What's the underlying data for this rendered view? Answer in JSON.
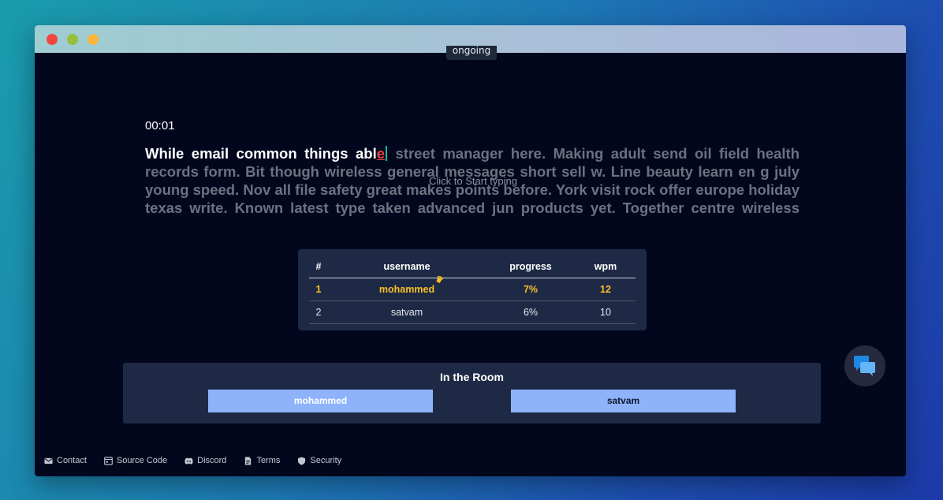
{
  "race": {
    "status": "ongoing",
    "timer": "00:01"
  },
  "passage": {
    "typed": "While email common things abl",
    "current_error": "e",
    "remaining": " street manager here. Making adult send oil field health records form. Bit though wireless general messages short sell w. Line beauty learn en g july young speed. Nov all file safety great makes points before. York visit rock offer europe holiday texas write. Known latest type taken advanced jun products yet. Together centre wireless learn wireless single in",
    "hint": "Click to Start typing"
  },
  "leaderboard": {
    "headers": {
      "rank": "#",
      "username": "username",
      "progress": "progress",
      "wpm": "wpm"
    },
    "rows": [
      {
        "rank": "1",
        "username": "mohammed",
        "progress": "7%",
        "wpm": "12",
        "crown_icon": "crown-icon"
      },
      {
        "rank": "2",
        "username": "satvam",
        "progress": "6%",
        "wpm": "10"
      }
    ]
  },
  "room": {
    "title": "In the Room",
    "players": [
      "mohammed",
      "satvam"
    ]
  },
  "footer": {
    "links": [
      {
        "label": "Contact",
        "icon": "mail-icon"
      },
      {
        "label": "Source Code",
        "icon": "code-window-icon"
      },
      {
        "label": "Discord",
        "icon": "discord-icon"
      },
      {
        "label": "Terms",
        "icon": "document-icon"
      },
      {
        "label": "Security",
        "icon": "shield-icon"
      }
    ]
  },
  "chat": {
    "icon": "chat-bubbles-icon",
    "color": "#1e88e5"
  },
  "colors": {
    "background": "#03071e",
    "panel": "#1e2a45",
    "leader": "#fbbf24",
    "player_chip": "#8eb3fb"
  }
}
